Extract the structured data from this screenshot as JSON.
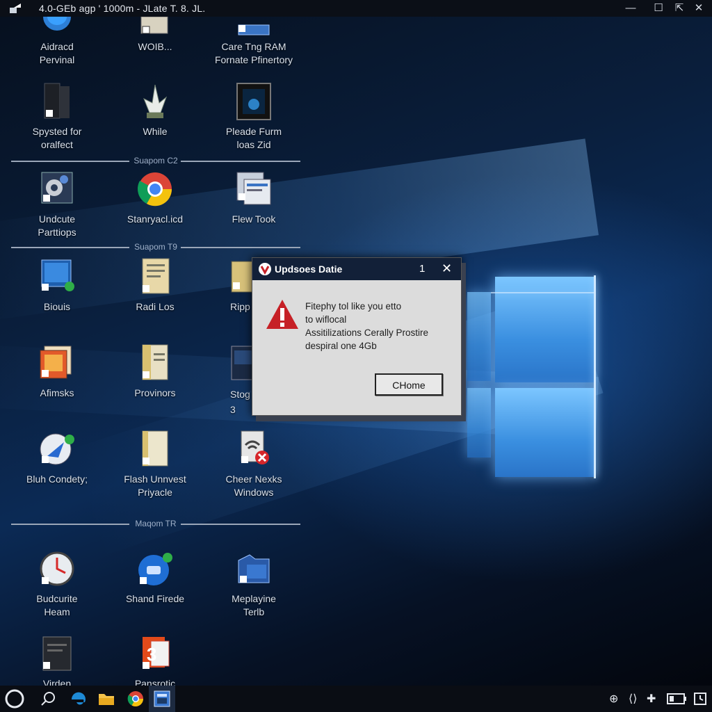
{
  "window": {
    "title": "4.0-GEb  agp  ' 1000m  - JLate T. 8. JL.",
    "controls": {
      "minimize": "—",
      "maximize": "☐",
      "restore": "⇱",
      "close": "✕"
    }
  },
  "icons": [
    {
      "id": "aidracd",
      "label": "Aidracd\nPervinal",
      "icon": "globe-icon"
    },
    {
      "id": "wolb",
      "label": "WOIB...",
      "icon": "folder-icon"
    },
    {
      "id": "care-ram",
      "label": "Care Tng RAM\nFornate Pfinertory",
      "icon": "memory-icon"
    },
    {
      "id": "spysted",
      "label": "Spysted for\noralfect",
      "icon": "tower-icon"
    },
    {
      "id": "while",
      "label": "While",
      "icon": "plant-icon"
    },
    {
      "id": "pleade",
      "label": "Pleade Furm\nloas Zid",
      "icon": "monitor-icon"
    },
    {
      "id": "undcute",
      "label": "Undcute\nParttiops",
      "icon": "settings-icon"
    },
    {
      "id": "stanryacl",
      "label": "Stanryacl.icd",
      "icon": "chrome-icon"
    },
    {
      "id": "flew-took",
      "label": "Flew Took",
      "icon": "document-icon"
    },
    {
      "id": "biouis",
      "label": "Biouis",
      "icon": "computer-icon"
    },
    {
      "id": "radi-los",
      "label": "Radi Los",
      "icon": "notebook-icon"
    },
    {
      "id": "ripp",
      "label": "Ripp",
      "icon": "app-icon"
    },
    {
      "id": "afimsks",
      "label": "Afimsks",
      "icon": "photos-icon"
    },
    {
      "id": "provinors",
      "label": "Provinors",
      "icon": "file-icon"
    },
    {
      "id": "stog",
      "label": "Stog\n3",
      "icon": "app-icon"
    },
    {
      "id": "bluh",
      "label": "Bluh Condety;",
      "icon": "network-icon"
    },
    {
      "id": "flash",
      "label": "Flash Unnvest\nPriyacle",
      "icon": "blank-file-icon"
    },
    {
      "id": "cheer",
      "label": "Cheer Nexks\nWindows",
      "icon": "wifi-error-icon"
    },
    {
      "id": "budcurite",
      "label": "Budcurite\nHeam",
      "icon": "clock-icon"
    },
    {
      "id": "shand",
      "label": "Shand Firede",
      "icon": "chat-icon"
    },
    {
      "id": "meplayine",
      "label": "Meplayine\nTerlb",
      "icon": "folder-blue-icon"
    },
    {
      "id": "virden",
      "label": "Virden",
      "icon": "dark-doc-icon"
    },
    {
      "id": "pansrotic",
      "label": "Pansrotic",
      "icon": "office-icon"
    }
  ],
  "separators": [
    "Suapom C2",
    "Suapom T9",
    "Maqom TR"
  ],
  "dialog": {
    "title": "Updsoes Datie",
    "counter": "1",
    "close": "✕",
    "line1": "Fitephy tol like you etto",
    "line2": "to wiflocal",
    "line3": "Assitilizations Cerally Prostire",
    "line4": "despiral one 4Gb",
    "button": "CHome",
    "icon": "warning-icon"
  },
  "taskbar": {
    "items": [
      "cortana-icon",
      "search-icon",
      "edge-icon",
      "file-explorer-icon",
      "chrome-icon",
      "app-icon"
    ],
    "tray": [
      "target-icon",
      "network-icon",
      "pin-icon",
      "battery-icon",
      "clock-icon"
    ]
  },
  "colors": {
    "dialog_title_bg": "#122038",
    "warning_red": "#c62026",
    "taskbar_bg": "#0a0d14"
  }
}
